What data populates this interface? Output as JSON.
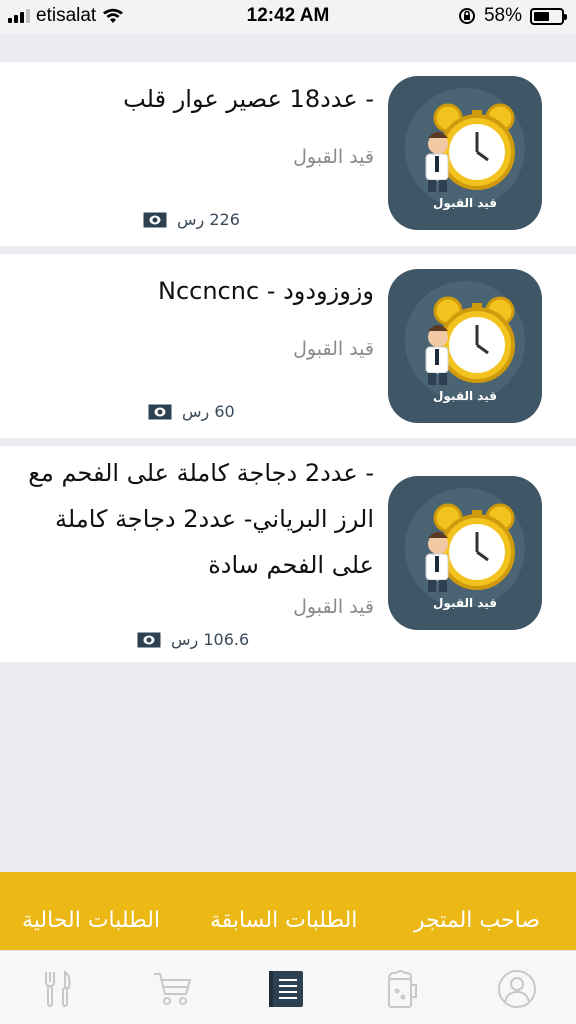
{
  "status_bar": {
    "carrier": "etisalat",
    "time": "12:42 AM",
    "battery": "58%",
    "battery_level": 0.58
  },
  "orders": [
    {
      "title": "- عدد18 عصير عوار قلب",
      "status": "قيد القبول",
      "price": "226 رس",
      "thumb_label": "قيد القبول"
    },
    {
      "title": "وزوزودود - Nccncnc",
      "status": "قيد القبول",
      "price": "60 رس",
      "thumb_label": "قيد القبول"
    },
    {
      "title": "- عدد2 دجاجة كاملة على الفحم مع الرز البرياني- عدد2 دجاجة كاملة على الفحم سادة",
      "status": "قيد القبول",
      "price": "106.6 رس",
      "thumb_label": "قيد القبول"
    }
  ],
  "tabs": {
    "store_owner": "صاحب المتجر",
    "previous_orders": "الطلبات السابقة",
    "current_orders": "الطلبات الحالية"
  },
  "bottom_nav": {
    "icons": [
      "restaurant-icon",
      "cart-icon",
      "orders-list-icon",
      "drink-icon",
      "profile-icon"
    ],
    "active": "orders-list-icon",
    "active_color": "#2e4150",
    "inactive_color": "#c8c8c8"
  },
  "colors": {
    "accent": "#ecb816",
    "thumb_bg": "#3f5666"
  }
}
